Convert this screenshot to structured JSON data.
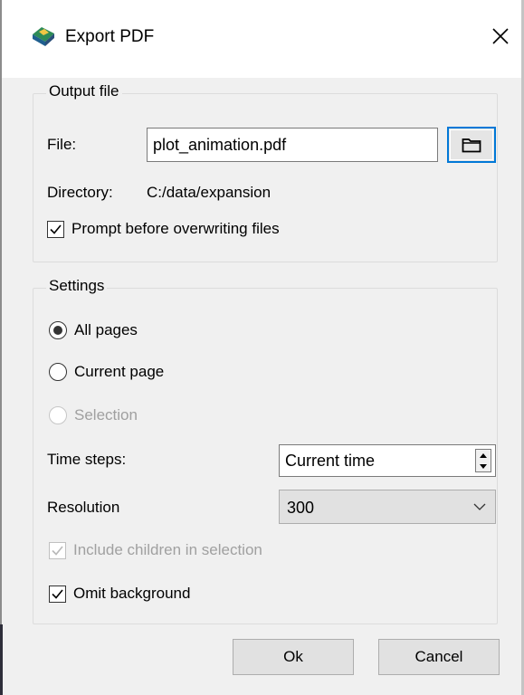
{
  "window": {
    "title": "Export PDF",
    "app_icon": "application-icon",
    "close_icon": "close-icon"
  },
  "output_file": {
    "group_title": "Output file",
    "file_label": "File:",
    "file_value": "plot_animation.pdf",
    "browse_icon": "folder-icon",
    "directory_label": "Directory:",
    "directory_value": "C:/data/expansion",
    "prompt_overwrite_label": "Prompt before overwriting files",
    "prompt_overwrite_checked": true
  },
  "settings": {
    "group_title": "Settings",
    "page_options": [
      {
        "label": "All pages",
        "checked": true,
        "enabled": true
      },
      {
        "label": "Current page",
        "checked": false,
        "enabled": true
      },
      {
        "label": "Selection",
        "checked": false,
        "enabled": false
      }
    ],
    "time_steps_label": "Time steps:",
    "time_steps_value": "Current time",
    "resolution_label": "Resolution",
    "resolution_value": "300",
    "include_children_label": "Include children in selection",
    "include_children_checked": true,
    "include_children_enabled": false,
    "omit_background_label": "Omit background",
    "omit_background_checked": true
  },
  "buttons": {
    "ok_label": "Ok",
    "cancel_label": "Cancel"
  },
  "colors": {
    "focus_accent": "#0078d7",
    "dialog_bg": "#f0f0f0"
  }
}
